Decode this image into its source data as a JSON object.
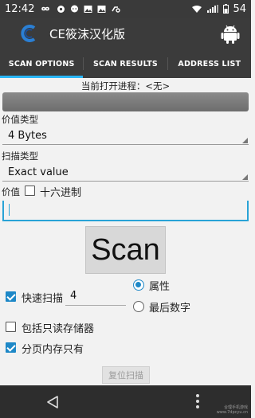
{
  "status_bar": {
    "time": "12:42",
    "battery": "54",
    "icons": [
      "infinity-icon",
      "settings-icon",
      "chat-icon",
      "image-icon",
      "image-icon",
      "link-icon"
    ],
    "right_icons": [
      "wifi-icon",
      "signal-icon",
      "battery-icon"
    ]
  },
  "app": {
    "title": "CE筱沫汉化版",
    "accent": "#29b6f6"
  },
  "tabs": [
    {
      "label": "SCAN OPTIONS",
      "active": true
    },
    {
      "label": "SCAN RESULTS",
      "active": false
    },
    {
      "label": "ADDRESS LIST",
      "active": false
    }
  ],
  "process": {
    "label": "当前打开进程：<无>"
  },
  "value_type": {
    "label": "价值类型",
    "selected": "4 Bytes"
  },
  "scan_type": {
    "label": "扫描类型",
    "selected": "Exact value"
  },
  "value": {
    "label": "价值",
    "hex_label": "十六进制",
    "hex_checked": false,
    "input_value": ""
  },
  "scan_button": "Scan",
  "quick_scan": {
    "label": "快速扫描",
    "checked": true,
    "value": "4"
  },
  "radio": {
    "attribute_label": "属性",
    "attribute_checked": true,
    "last_digit_label": "最后数字",
    "last_digit_checked": false
  },
  "readonly_memory": {
    "label": "包括只读存储器",
    "checked": false
  },
  "paged_memory": {
    "label": "分页内存只有",
    "checked": true
  },
  "reset_button": "复位扫描",
  "watermark": {
    "line1": "合理手机游戏",
    "line2": "www.7dpcyu.cn"
  }
}
